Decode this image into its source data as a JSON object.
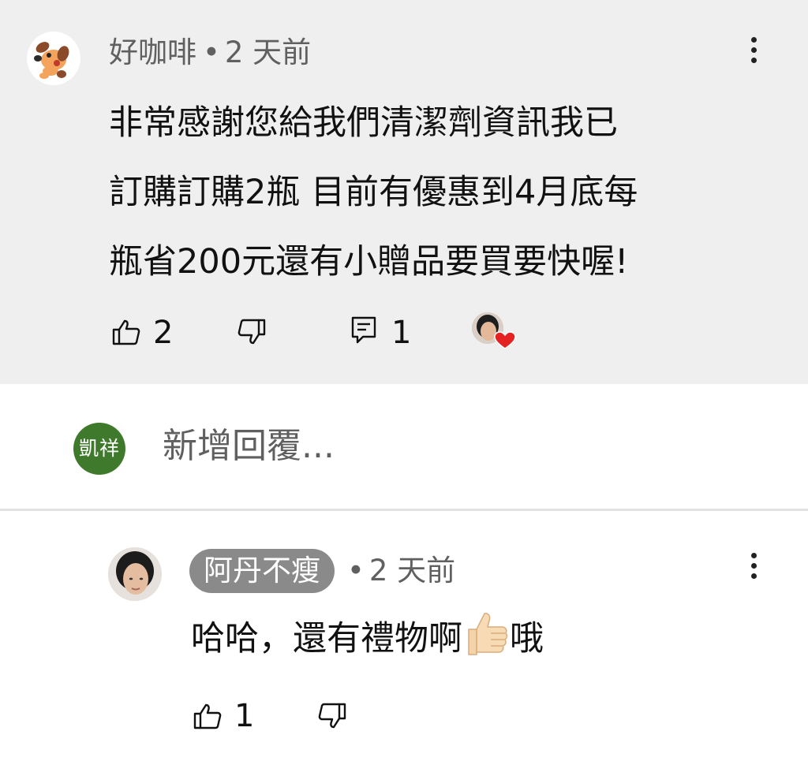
{
  "comment": {
    "author": "好咖啡",
    "time": "2 天前",
    "text_lines": [
      "非常感謝您給我們清潔劑資訊我已",
      "訂購訂購2瓶 目前有優惠到4月底每",
      "瓶省200元還有小贈品要買要快喔!"
    ],
    "like_count": "2",
    "reply_count": "1",
    "highlight_color": "#efefef"
  },
  "add_reply": {
    "avatar_text": "凱祥",
    "avatar_color": "#3f7a2c",
    "placeholder": "新增回覆..."
  },
  "reply": {
    "author": "阿丹不瘦",
    "time": "2 天前",
    "text_before_emoji": "哈哈，還有禮物啊",
    "emoji": "thumbs-up-emoji",
    "text_after_emoji": "哦",
    "like_count": "1",
    "author_chip_color": "#8a8a8a"
  },
  "icons": {
    "like": "thumbs-up-icon",
    "dislike": "thumbs-down-icon",
    "reply": "comment-icon",
    "more": "more-vert-icon",
    "heart": "heart-icon"
  }
}
